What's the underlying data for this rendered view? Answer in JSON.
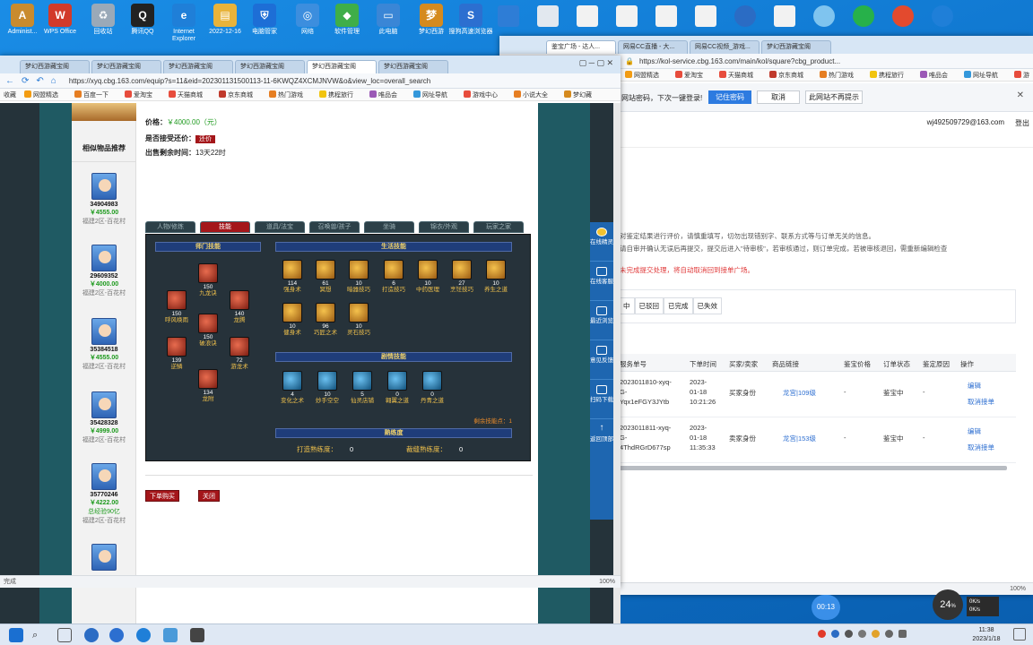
{
  "desktop_icons": [
    {
      "label": "Administ...",
      "color": "#c98b2e"
    },
    {
      "label": "WPS Office",
      "color": "#d23a2a"
    },
    {
      "label": "回收站",
      "color": "#9aa9b8"
    },
    {
      "label": "腾讯QQ",
      "color": "#222222"
    },
    {
      "label": "Internet Explorer",
      "color": "#1f7fd8"
    },
    {
      "label": "2022-12-16",
      "color": "#e8b33a"
    },
    {
      "label": "电脑管家",
      "color": "#1d6ed6"
    },
    {
      "label": "网络",
      "color": "#3c8ede"
    },
    {
      "label": "软件管理",
      "color": "#3fae49"
    },
    {
      "label": "此电脑",
      "color": "#3a86d6"
    },
    {
      "label": "梦幻西游",
      "color": "#d58a1e"
    },
    {
      "label": "搜狗高速浏览器",
      "color": "#2c6fd0"
    }
  ],
  "left_browser": {
    "tabs": [
      "梦幻西游藏宝阁",
      "梦幻西游藏宝阁",
      "梦幻西游藏宝阁",
      "梦幻西游藏宝阁",
      "梦幻西游藏宝阁",
      "梦幻西游藏宝阁"
    ],
    "url": "https://xyq.cbg.163.com/equip?s=11&eid=202301131500113-11-6KWQZ4XCMJNVW&o&view_loc=overall_search",
    "bookmarks": [
      "收藏",
      "网盟精选",
      "百度一下",
      "爱淘宝",
      "天猫商城",
      "京东商城",
      "热门游戏",
      "携程旅行",
      "唯品会",
      "网址导航",
      "游戏中心",
      "小说大全",
      "梦幻藏"
    ],
    "status": "完成",
    "zoom": "100%"
  },
  "item": {
    "price_label": "价格：",
    "price": "￥4000.00（元）",
    "bargain_label": "是否接受还价：",
    "bargain_btn": "还价",
    "remaining_label": "出售剩余时间：",
    "remaining": "13天22时"
  },
  "similar": {
    "title": "相似物品推荐",
    "items": [
      {
        "id": "34904983",
        "price": "￥4555.00",
        "server": "福建2区-百花村",
        "note": ""
      },
      {
        "id": "29609352",
        "price": "￥4000.00",
        "server": "福建2区-百花村",
        "note": ""
      },
      {
        "id": "35384518",
        "price": "￥4555.00",
        "server": "福建2区-百花村",
        "note": ""
      },
      {
        "id": "35428328",
        "price": "￥4999.00",
        "server": "福建2区-百花村",
        "note": ""
      },
      {
        "id": "35770246",
        "price": "￥4222.00",
        "server": "福建2区-百花村",
        "note": "总经验90亿"
      }
    ]
  },
  "tabs": [
    "人物/修炼",
    "技能",
    "道具/法宝",
    "召唤兽/孩子",
    "坐骑",
    "锦衣/外观",
    "玩家之家"
  ],
  "master_skills": {
    "title": "师门技能",
    "items": [
      {
        "lv": "150",
        "name": "九龙诀"
      },
      {
        "lv": "150",
        "name": "呼风唤雨"
      },
      {
        "lv": "140",
        "name": "龙腾"
      },
      {
        "lv": "150",
        "name": "破浪诀"
      },
      {
        "lv": "139",
        "name": "逆鳞"
      },
      {
        "lv": "72",
        "name": "游龙术"
      },
      {
        "lv": "134",
        "name": "龙附"
      }
    ]
  },
  "life_skills": {
    "title": "生活技能",
    "items": [
      {
        "lv": "114",
        "name": "强身术"
      },
      {
        "lv": "61",
        "name": "冥想"
      },
      {
        "lv": "10",
        "name": "暗器技巧"
      },
      {
        "lv": "6",
        "name": "打造技巧"
      },
      {
        "lv": "10",
        "name": "中药医理"
      },
      {
        "lv": "27",
        "name": "烹饪技巧"
      },
      {
        "lv": "10",
        "name": "养生之道"
      },
      {
        "lv": "10",
        "name": "健身术"
      },
      {
        "lv": "96",
        "name": "巧匠之术"
      },
      {
        "lv": "10",
        "name": "灵石技巧"
      }
    ]
  },
  "plot_skills": {
    "title": "剧情技能",
    "items": [
      {
        "lv": "4",
        "name": "变化之术"
      },
      {
        "lv": "10",
        "name": "妙手空空"
      },
      {
        "lv": "5",
        "name": "仙灵店铺"
      },
      {
        "lv": "0",
        "name": "翱翼之道"
      },
      {
        "lv": "0",
        "name": "丹青之道"
      }
    ],
    "remaining": "剩余技能点：1"
  },
  "proficiency": {
    "title": "熟练度",
    "forge": "打造熟练度：",
    "forge_val": "0",
    "tailor": "裁缝熟练度：",
    "tailor_val": "0"
  },
  "actions": {
    "order": "下单购买",
    "close": "关闭"
  },
  "side_buttons": [
    "在线精灵",
    "在线客服",
    "最近浏览",
    "意见反馈",
    "扫码下载",
    "返回顶部"
  ],
  "right_browser": {
    "tabs": [
      "鉴宝广场 - 达人...",
      "网易CC直播 - 大...",
      "网易CC视频_游戏...",
      "梦幻西游藏宝阁"
    ],
    "url": "https://kol-service.cbg.163.com/main/kol/square?cbg_product...",
    "bookmarks": [
      "网盟精选",
      "爱淘宝",
      "天猫商城",
      "京东商城",
      "热门游戏",
      "携程旅行",
      "唯品会",
      "网址导航",
      "游"
    ],
    "password_prompt": "网站密码，下次一键登录!",
    "remember_btn": "记住密码",
    "cancel_btn": "取消",
    "never_btn": "此网站不再提示",
    "email": "wj492509729@163.com",
    "logout": "登出",
    "notice1": "对鉴定结果进行评价，请慎重填写，切勿出现错别字、联系方式等与订单无关的信息。",
    "notice2": "请自审并确认无误后再提交，提交后进入\"待审核\"，若审核通过，则订单完成，若被审核退回，需重新编辑检查",
    "notice3": "未完成提交处理，将自动取消回到接单广场。",
    "status_tabs": [
      "中",
      "已驳回",
      "已完成",
      "已失效"
    ],
    "headers": [
      "服务单号",
      "下单时间",
      "买家/卖家",
      "商品链接",
      "鉴宝价格",
      "订单状态",
      "鉴定原因",
      "操作"
    ],
    "rows": [
      {
        "no1": "2023011810-xyq-",
        "no2": "G-",
        "no3": "Yqx1eFGY3JYtb",
        "t1": "2023-",
        "t2": "01-18",
        "t3": "10:21:26",
        "role": "买家身份",
        "link": "龙宫|109级",
        "price": "-",
        "state": "鉴宝中",
        "reason": "-",
        "a1": "编辑",
        "a2": "取消接单"
      },
      {
        "no1": "2023011811-xyq-",
        "no2": "G-",
        "no3": "4ThdRGrD677sp",
        "t1": "2023-",
        "t2": "01-18",
        "t3": "11:35:33",
        "role": "卖家身份",
        "link": "龙宫|153级",
        "price": "-",
        "state": "鉴宝中",
        "reason": "-",
        "a1": "编辑",
        "a2": "取消接单"
      }
    ],
    "zoom": "100%"
  },
  "overlay": {
    "timer": "00:13",
    "percent": "24",
    "percent_unit": "%",
    "net_up": "0K/s",
    "net_down": "0K/s"
  },
  "clock": {
    "time": "11:38",
    "date": "2023/1/18"
  }
}
